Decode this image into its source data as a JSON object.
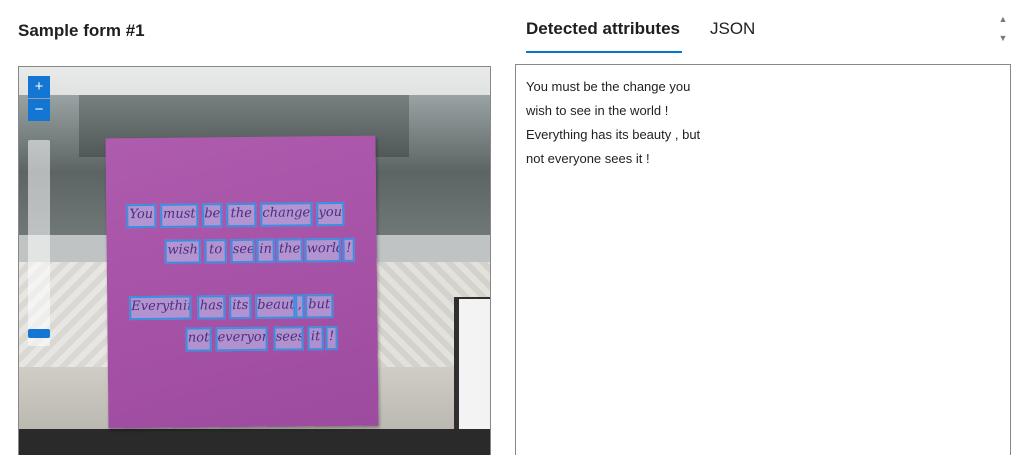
{
  "left_panel": {
    "title": "Sample form #1",
    "zoom": {
      "in_label": "+",
      "out_label": "−"
    },
    "note_lines": [
      [
        "You",
        "must",
        "be",
        "the",
        "change",
        "you"
      ],
      [
        "wish",
        "to",
        "see",
        "in",
        "the",
        "world",
        "!"
      ],
      [
        "Everything",
        "has",
        "its",
        "beauty",
        ",",
        "but"
      ],
      [
        "not",
        "everyone",
        "sees",
        "it",
        "!"
      ]
    ]
  },
  "right_panel": {
    "tabs": [
      {
        "label": "Detected attributes",
        "active": true
      },
      {
        "label": "JSON",
        "active": false
      }
    ],
    "detected_lines": [
      "You must be the change you",
      "wish to see in the world !",
      "Everything has its beauty , but",
      "not everyone sees it !"
    ]
  },
  "colors": {
    "accent": "#0078d4",
    "word_box_border": "#3c8fe0",
    "sticky_note": "#a753a8"
  },
  "icons": {
    "scroll_up": "scroll-up-arrow-icon",
    "scroll_down": "scroll-down-arrow-icon"
  }
}
